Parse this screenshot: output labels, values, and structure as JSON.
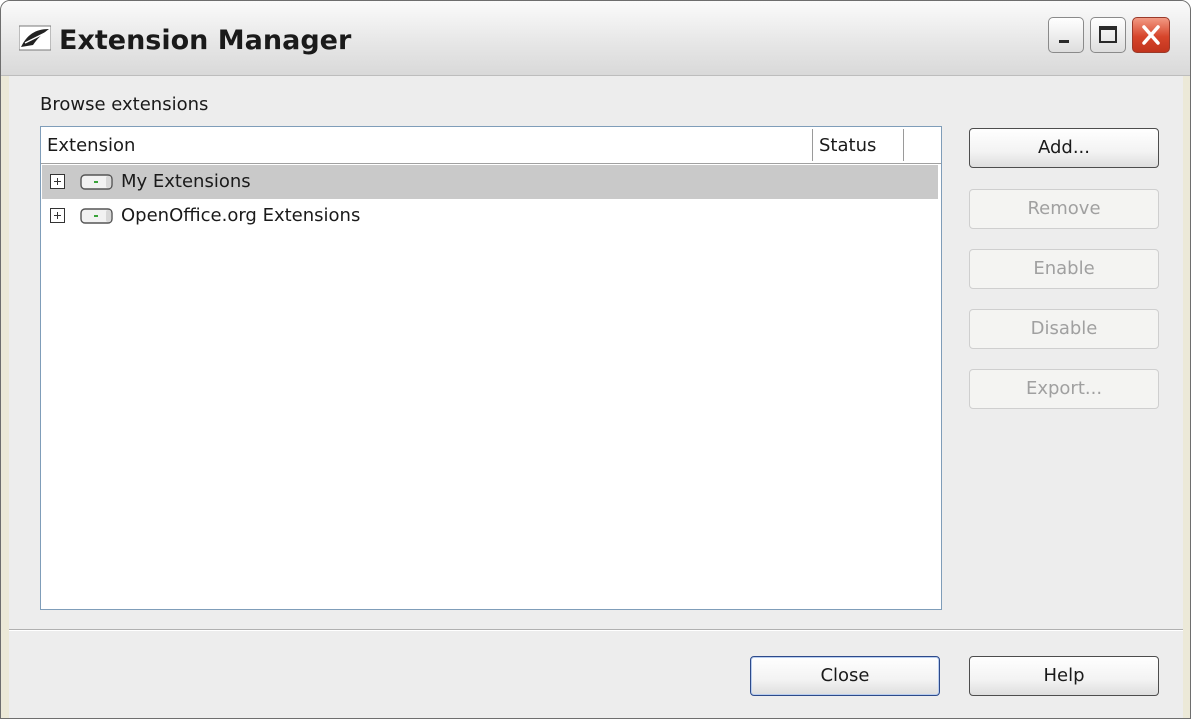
{
  "window": {
    "title": "Extension Manager",
    "icon": "openoffice-gull-icon"
  },
  "titlebar_buttons": [
    "minimize-icon",
    "maximize-icon",
    "close-icon"
  ],
  "browse_label": "Browse extensions",
  "list": {
    "columns": [
      "Extension",
      "Status"
    ],
    "rows": [
      {
        "label": "My Extensions",
        "icon": "drive-icon",
        "expanded": false,
        "selected": true
      },
      {
        "label": "OpenOffice.org Extensions",
        "icon": "drive-icon",
        "expanded": false,
        "selected": false
      }
    ]
  },
  "buttons": {
    "add": "Add...",
    "remove": "Remove",
    "enable": "Enable",
    "disable": "Disable",
    "export": "Export...",
    "close": "Close",
    "help": "Help"
  },
  "colors": {
    "selection": "#c9c9c9",
    "close_button": "#d6452b",
    "disabled_text": "#a0a0a0"
  }
}
